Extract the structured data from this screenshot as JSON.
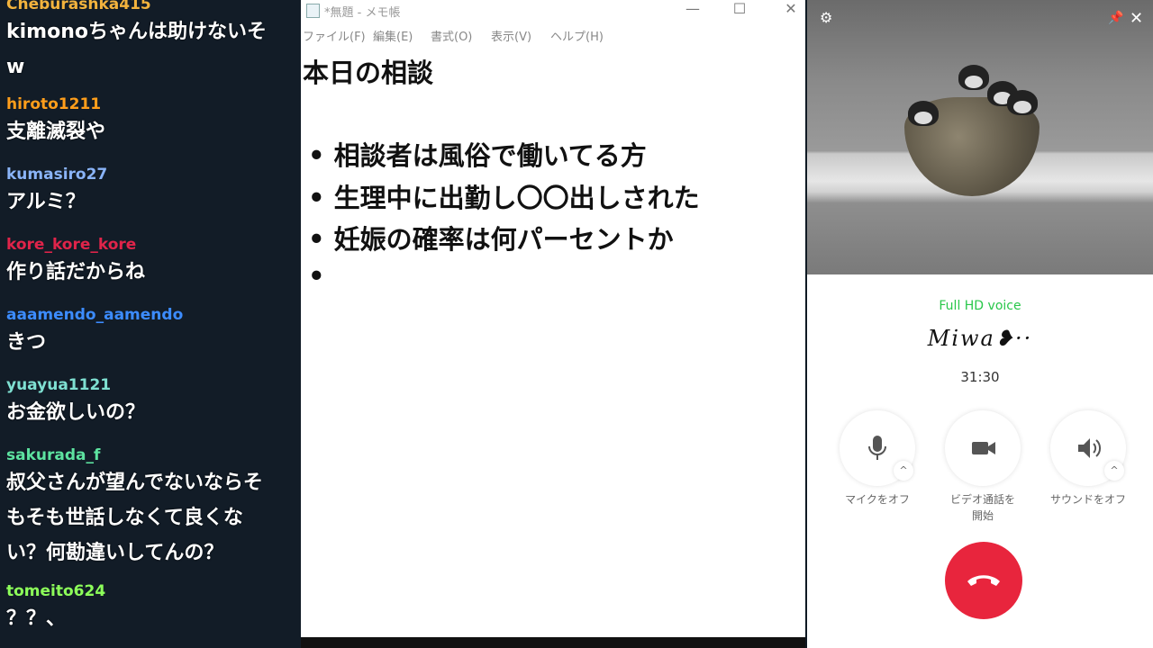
{
  "chat": {
    "messages": [
      {
        "user": "Cheburashka415",
        "color": "#f3b33d",
        "text": "kimonoちゃんは助けないそ\nw"
      },
      {
        "user": "hiroto1211",
        "color": "#ff9e1b",
        "text": "支離滅裂や"
      },
      {
        "user": "kumasiro27",
        "color": "#8ab4f8",
        "text": "アルミ？"
      },
      {
        "user": "kore_kore_kore",
        "color": "#e0244a",
        "text": "作り話だからね"
      },
      {
        "user": "aaamendo_aamendo",
        "color": "#3c8cff",
        "text": "きつ"
      },
      {
        "user": "yuayua1121",
        "color": "#7fe0d2",
        "text": "お金欲しいの？"
      },
      {
        "user": "sakurada_f",
        "color": "#5de3a0",
        "text": "叔父さんが望んでないならそ\nもそも世話しなくて良くな\nい？何勘違いしてんの？"
      },
      {
        "user": "tomeito624",
        "color": "#8dff5a",
        "text": "？？、"
      }
    ]
  },
  "notepad": {
    "title": "*無題 - メモ帳",
    "menu": [
      "ファイル(F)",
      "編集(E)",
      "書式(O)",
      "表示(V)",
      "ヘルプ(H)"
    ],
    "heading": "本日の相談",
    "bullets": [
      "• 相談者は風俗で働いてる方",
      "• 生理中に出勤し〇〇出しされた",
      "• 妊娠の確率は何パーセントか",
      "•"
    ]
  },
  "call": {
    "voice_quality": "Full HD voice",
    "caller_name": "Miwa❥··",
    "duration": "31:30",
    "controls": [
      {
        "label": "マイクをオフ",
        "icon": "microphone-icon"
      },
      {
        "label": "ビデオ通話を\n開始",
        "icon": "video-camera-icon"
      },
      {
        "label": "サウンドをオフ",
        "icon": "speaker-icon"
      }
    ],
    "hangup_color": "#e8253d",
    "accent_green": "#29c74a"
  }
}
